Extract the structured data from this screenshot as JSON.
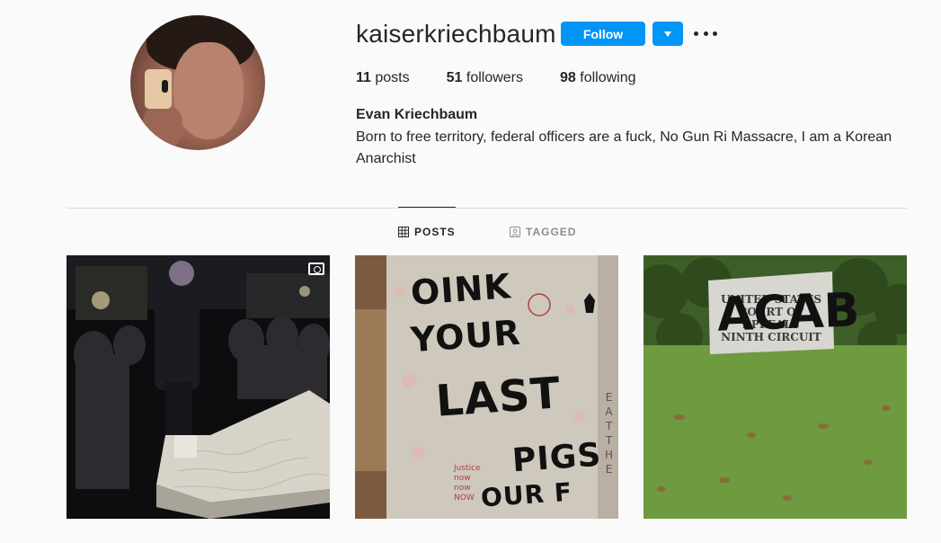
{
  "profile": {
    "username": "kaiserkriechbaum",
    "follow_label": "Follow",
    "full_name": "Evan Kriechbaum",
    "bio": "Born to free territory, federal officers are a fuck, No Gun Ri Massacre, I am a Korean Anarchist"
  },
  "stats": {
    "posts_count": "11",
    "posts_label": "posts",
    "followers_count": "51",
    "followers_label": "followers",
    "following_count": "98",
    "following_label": "following"
  },
  "tabs": [
    {
      "label": "POSTS",
      "icon": "grid-icon",
      "active": true
    },
    {
      "label": "TAGGED",
      "icon": "tag-icon",
      "active": false
    }
  ],
  "posts": [
    {
      "kind": "video",
      "icon": "reel-icon"
    },
    {
      "kind": "image",
      "graffiti": [
        "OINK",
        "YOUR",
        "LAST",
        "PIGS",
        "OUR F"
      ],
      "small_text": [
        "Justice",
        "now",
        "now",
        "NOW"
      ],
      "side_text": [
        "E",
        "A",
        "T",
        "T",
        "H",
        "E"
      ]
    },
    {
      "kind": "image",
      "graffiti": "ACAB",
      "sign_lines": [
        "UNITED STATES",
        "COURT OF APPEALS",
        "NINTH CIRCUIT"
      ]
    }
  ],
  "colors": {
    "accent": "#0095f6",
    "text": "#262626",
    "muted": "#8e8e8e",
    "divider": "#dbdbdb",
    "background": "#fafafa"
  }
}
